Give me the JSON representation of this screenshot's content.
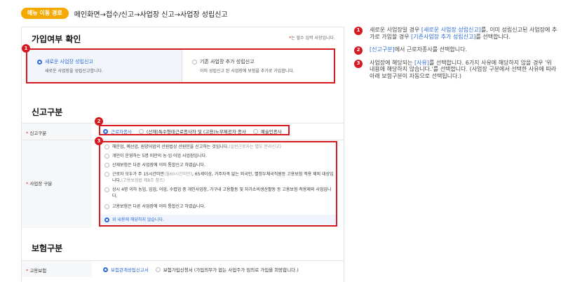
{
  "top": {
    "badge": "메뉴 이동 경로",
    "path": "메인화면→접수/신고→사업장 신고→사업장 성립신고"
  },
  "join": {
    "title": "가입여부 확인",
    "required_note_mark": "*",
    "required_note": "는 필수 입력 사항입니다.",
    "marker": "1",
    "options": [
      {
        "title": "새로운 사업장 성립신고",
        "desc": "새로운 사업장을 성립신고합니다.",
        "selected": true
      },
      {
        "title": "기존 사업장 추가 성립신고",
        "desc": "이미 성립신고 된 사업장에 보험을 추가로 가입합니다.",
        "selected": false
      }
    ]
  },
  "report": {
    "title": "신고구분",
    "row1_mark": "*",
    "row1_label": "신고구분",
    "marker2": "2",
    "types": [
      {
        "label": "근로자종사",
        "selected": true
      },
      {
        "label": "(산재)특수형태근로종사자 및 (고용)노무제공자 종사",
        "selected": false
      },
      {
        "label": "예술인종사",
        "selected": false
      }
    ],
    "row2_mark": "*",
    "row2_label": "사업장 구분",
    "marker3": "3",
    "reasons": [
      {
        "text": "해운업, 예선업, 원양어업의 선원법상 선원만을 신고하는 것입니다.",
        "note": "(일반근로자는 별도 분리신고)",
        "selected": false
      },
      {
        "text": "개인이 운영하는 5명 미만의 농·임·어업 사업장입니다.",
        "note": "",
        "selected": false
      },
      {
        "text": "산재보험은 다른 사업장에 이미 통합신고 하였습니다.",
        "note": "",
        "selected": false
      },
      {
        "text": "근로자 모두가 주 15시간미만",
        "note": "(월60시간미만)",
        "text2": ", 65세이상, 거주자격 없는 외국인, 별정우체국직원등 고용보험 적용 제외 대상입니다.",
        "note2": "(고용보험법 제8조 참조)",
        "selected": false
      },
      {
        "text": "상시 4명 이하 농업, 임업, 어업, 수렵업 중 개인사업장, 가구내 고용활동 및 자가소비생산활동 등 고용보험 적용제외 사업입니다.",
        "note": "",
        "selected": false
      },
      {
        "text": "고용보험은 다른 사업장에 이미 통합신고 하였습니다.",
        "note": "",
        "selected": false
      },
      {
        "text": "위 내용에 해당하지 않습니다.",
        "note": "",
        "selected": true
      }
    ]
  },
  "insurance": {
    "title": "보험구분",
    "row_mark": "*",
    "row_label": "고용보험",
    "options": [
      {
        "label": "보험관계성립신고서",
        "selected": true
      },
      {
        "label": "보험가입신청서 (가입의무가 없는 사업주가 임의로 가입을 희망합니다.)",
        "selected": false
      }
    ]
  },
  "notes": [
    {
      "num": "1",
      "a": "새로운 사업장일 경우 ",
      "h1": "[새로운 사업장 성립신고]",
      "b": "를, 이미 성립신고된 사업장에 추가로 가입할 경우 ",
      "h2": "[기존사업장 추가 성립신고]",
      "c": "를 선택합니다."
    },
    {
      "num": "2",
      "h1": "[신고구분]",
      "a": "에서 근로자종사를 선택합니다."
    },
    {
      "num": "3",
      "a": "사업장에 해당되는 ",
      "h1": "[사유]",
      "b": "를 선택합니다. 6가지 사유에 해당하지 않을 경우 '위 내용에 해당하지 않습니다.'를 선택합니다. (사업장 구분에서 선택한 사유에 따라 아래 보험구분이 자동으로 선택됩니다.)"
    }
  ],
  "colors": {
    "accent": "#2a6ad8",
    "marker": "#d71920",
    "badge": "#f5a800"
  }
}
